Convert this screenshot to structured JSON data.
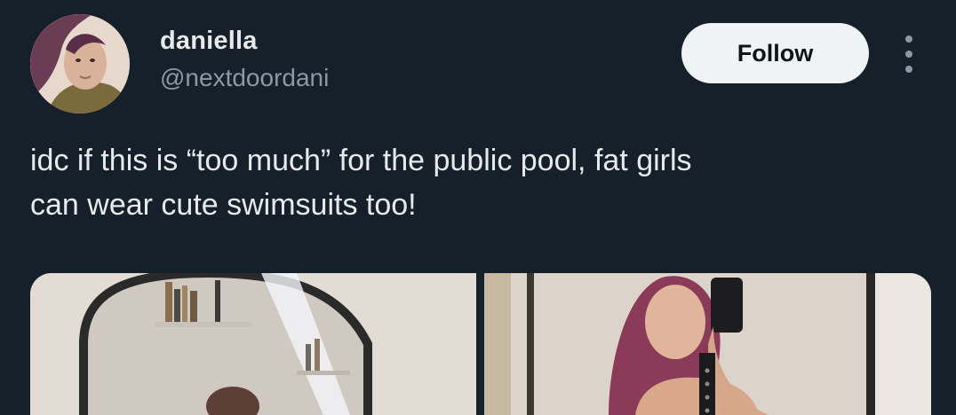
{
  "author": {
    "display_name": "daniella",
    "handle": "@nextdoordani"
  },
  "actions": {
    "follow_label": "Follow"
  },
  "tweet": {
    "line1": "idc if this is “too much” for the public pool, fat girls",
    "line2": "can wear cute swimsuits too!"
  },
  "colors": {
    "background": "#15202b",
    "primary_text": "#e7e9ea",
    "secondary_text": "#8b98a5",
    "button_bg": "#eff3f4"
  },
  "icons": {
    "more": "more-vertical-icon",
    "avatar": "avatar-photo"
  }
}
